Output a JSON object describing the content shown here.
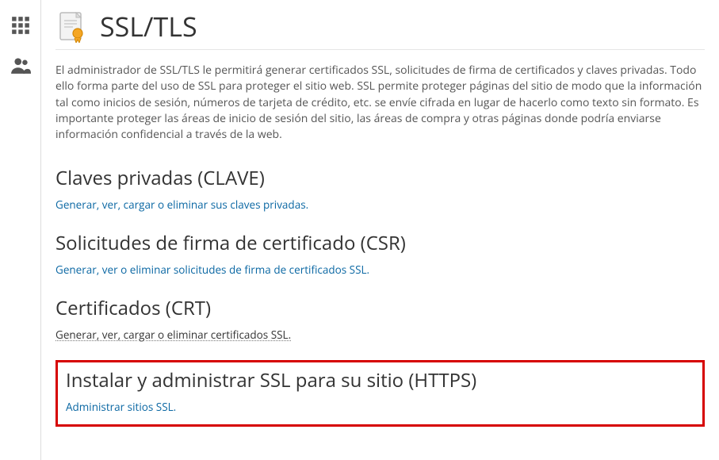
{
  "sidebar": {
    "items": [
      {
        "name": "apps-icon"
      },
      {
        "name": "users-icon"
      }
    ]
  },
  "page": {
    "title": "SSL/TLS",
    "intro": "El administrador de SSL/TLS le permitirá generar certificados SSL, solicitudes de firma de certificados y claves privadas. Todo ello forma parte del uso de SSL para proteger el sitio web. SSL permite proteger páginas del sitio de modo que la información tal como inicios de sesión, números de tarjeta de crédito, etc. se envíe cifrada en lugar de hacerlo como texto sin formato. Es importante proteger las áreas de inicio de sesión del sitio, las áreas de compra y otras páginas donde podría enviarse información confidencial a través de la web."
  },
  "sections": {
    "private_keys": {
      "heading": "Claves privadas (CLAVE)",
      "link": "Generar, ver, cargar o eliminar sus claves privadas."
    },
    "csr": {
      "heading": "Solicitudes de firma de certificado (CSR)",
      "link": "Generar, ver o eliminar solicitudes de firma de certificados SSL."
    },
    "crt": {
      "heading": "Certificados (CRT)",
      "link_prefix": "Generar, ver, cargar o eliminar",
      "link_suffix": " certificados SSL."
    },
    "install": {
      "heading": "Instalar y administrar SSL para su sitio (HTTPS)",
      "link": "Administrar sitios SSL."
    }
  }
}
